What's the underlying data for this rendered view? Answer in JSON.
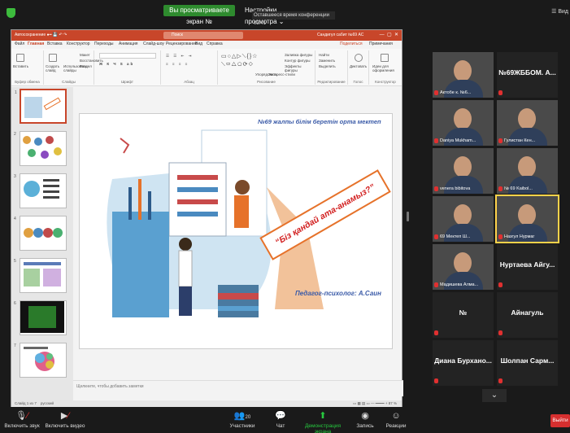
{
  "zoom": {
    "share_banner": "Вы просматриваете экран №",
    "view_options": "Настройки просмотра",
    "conference_time": "Оставшееся время конференции 03:41",
    "view_label": "Вид"
  },
  "ppt": {
    "autosave": "Автосохранение",
    "search": "Поиск",
    "user": "Сандигүл сабит №69 АС",
    "tabs": [
      "Файл",
      "Главная",
      "Вставка",
      "Конструктор",
      "Переходы",
      "Анимация",
      "Слайд-шоу",
      "Рецензирование",
      "Вид",
      "Справка"
    ],
    "share": "Поделиться",
    "notes_btn": "Примечания",
    "ribbon_groups": [
      "Буфер обмена",
      "Слайды",
      "Шрифт",
      "Абзац",
      "Рисование",
      "Редактирование",
      "Голос",
      "Конструктор"
    ],
    "ribbon_buttons": {
      "paste": "Вставить",
      "new_slide": "Создать слайд",
      "reuse": "Использовать слайды",
      "layout": "Макет",
      "reset": "Восстановить",
      "section": "Раздел",
      "arrange": "Упорядочить",
      "quick_styles": "Экспресс-стили",
      "fill": "Заливка фигуры",
      "outline": "Контур фигуры",
      "effects": "Эффекты фигуры",
      "find": "Найти",
      "replace": "Заменить",
      "select": "Выделить",
      "dictate": "Диктовать",
      "designer": "Идеи для оформления"
    },
    "slide": {
      "school": "№69 жалпы білім беретін орта мектеп",
      "banner": "“Біз қандай ата-анамыз?”",
      "psychologist": "Педагог-психолог: А.Саин"
    },
    "notes_placeholder": "Щелкните, чтобы добавить заметки",
    "status_left": "Слайд 1 из 7",
    "status_lang": "русский",
    "status_zoom": "87 %",
    "thumb_numbers": [
      "1",
      "2",
      "3",
      "4",
      "5",
      "6",
      "7"
    ]
  },
  "participants": [
    {
      "name": "Актобе к. №6...",
      "type": "photo"
    },
    {
      "name": "№69ЖББОМ. А...",
      "type": "text"
    },
    {
      "name": "Daniya Mukham...",
      "type": "photo"
    },
    {
      "name": "Гулистан Кен...",
      "type": "photo"
    },
    {
      "name": "venera bibitova",
      "type": "photo"
    },
    {
      "name": "№ 69 Kaibol...",
      "type": "photo"
    },
    {
      "name": "69 Мектеп Ш...",
      "type": "photo"
    },
    {
      "name": "Назгул Нурмаг",
      "type": "photo"
    },
    {
      "name": "Мадишева Алма...",
      "type": "photo"
    },
    {
      "name": "Нуртаева Айгу...",
      "type": "text"
    },
    {
      "name": "№",
      "type": "text"
    },
    {
      "name": "Айнагуль",
      "type": "text"
    },
    {
      "name": "Диана Бурхано...",
      "type": "text"
    },
    {
      "name": "Шолпан Сарм...",
      "type": "text"
    }
  ],
  "toolbar": {
    "audio": "Включить звук",
    "video": "Включить видео",
    "participants": "Участники",
    "participants_count": "20",
    "chat": "Чат",
    "share": "Демонстрация экрана",
    "record": "Запись",
    "reactions": "Реакции",
    "leave": "Выйти"
  }
}
